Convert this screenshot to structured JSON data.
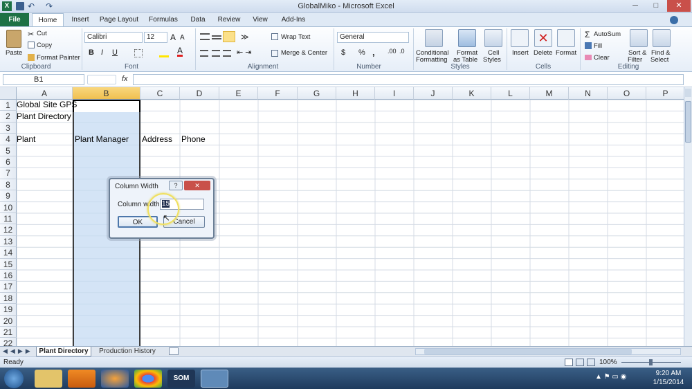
{
  "title_bar": {
    "title": "GlobalMiko  -  Microsoft Excel",
    "min": "─",
    "max": "□",
    "close": "✕"
  },
  "tabs": [
    "File",
    "Home",
    "Insert",
    "Page Layout",
    "Formulas",
    "Data",
    "Review",
    "View",
    "Add-Ins"
  ],
  "clipboard": {
    "paste": "Paste",
    "cut": "Cut",
    "copy": "Copy",
    "format_painter": "Format Painter",
    "label": "Clipboard"
  },
  "font": {
    "name": "Calibri",
    "size": "12",
    "label": "Font",
    "bold": "B",
    "italic": "I",
    "underline": "U"
  },
  "alignment": {
    "wrap": "Wrap Text",
    "merge": "Merge & Center",
    "label": "Alignment"
  },
  "number": {
    "format": "General",
    "dollar": "$",
    "percent": "%",
    "comma": ",",
    "label": "Number"
  },
  "styles": {
    "cond": "Conditional",
    "cond2": "Formatting",
    "fmt_table": "Format",
    "fmt_table2": "as Table",
    "cell_styles": "Cell",
    "cell_styles2": "Styles",
    "label": "Styles"
  },
  "cells": {
    "insert": "Insert",
    "delete": "Delete",
    "format": "Format",
    "label": "Cells"
  },
  "editing": {
    "autosum": "AutoSum",
    "fill": "Fill",
    "clear": "Clear",
    "sort": "Sort &",
    "sort2": "Filter",
    "find": "Find &",
    "find2": "Select",
    "label": "Editing"
  },
  "formula_bar": {
    "name_box": "B1",
    "fx": "fx",
    "content": ""
  },
  "columns": [
    "A",
    "B",
    "C",
    "D",
    "E",
    "F",
    "G",
    "H",
    "I",
    "J",
    "K",
    "L",
    "M",
    "N",
    "O",
    "P"
  ],
  "rows": [
    "1",
    "2",
    "3",
    "4",
    "5",
    "6",
    "7",
    "8",
    "9",
    "10",
    "11",
    "12",
    "13",
    "14",
    "15",
    "16",
    "17",
    "18",
    "19",
    "20",
    "21",
    "22"
  ],
  "cells_data": {
    "A1": "Global Site GPS",
    "A2": "Plant Directory",
    "A4": "Plant",
    "B4": "Plant Manager",
    "C4": "Address",
    "D4": "Phone"
  },
  "dialog": {
    "title": "Column Width",
    "help": "?",
    "close": "✕",
    "field_label": "Column width:",
    "value": "15",
    "ok": "OK",
    "cancel": "Cancel"
  },
  "sheets": {
    "active": "Plant Directory",
    "other": "Production History"
  },
  "status": {
    "ready": "Ready",
    "zoom": "100%"
  },
  "taskbar": {
    "time": "9:20 AM",
    "date": "1/15/2014",
    "som": "SOM"
  },
  "colors": {
    "accent": "#1e7145",
    "selection": "#bcd8f4"
  }
}
